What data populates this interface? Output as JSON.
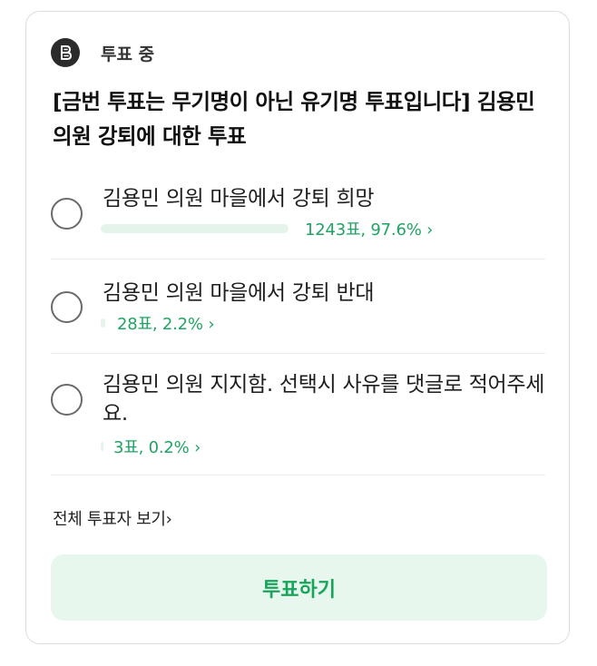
{
  "poll": {
    "status": "투표 중",
    "title": "[금번 투표는 무기명이 아닌 유기명 투표입니다] 김용민 의원 강퇴에 대한 투표",
    "options": [
      {
        "label": "김용민 의원 마을에서 강퇴 희망",
        "result": "1243표, 97.6% ›",
        "percent": 97.6
      },
      {
        "label": "김용민 의원 마을에서 강퇴 반대",
        "result": "28표, 2.2% ›",
        "percent": 2.2
      },
      {
        "label": "김용민 의원 지지함. 선택시 사유를 댓글로 적어주세요.",
        "result": "3표, 0.2% ›",
        "percent": 0.2
      }
    ],
    "view_all": "전체 투표자 보기›",
    "vote_button": "투표하기"
  },
  "colors": {
    "accent": "#1fa463",
    "bar_fill": "#e4f4ea",
    "button_bg": "#e8f7ee",
    "logo_bg": "#2b2b2b"
  },
  "icons": {
    "logo": "poll-logo-icon"
  }
}
